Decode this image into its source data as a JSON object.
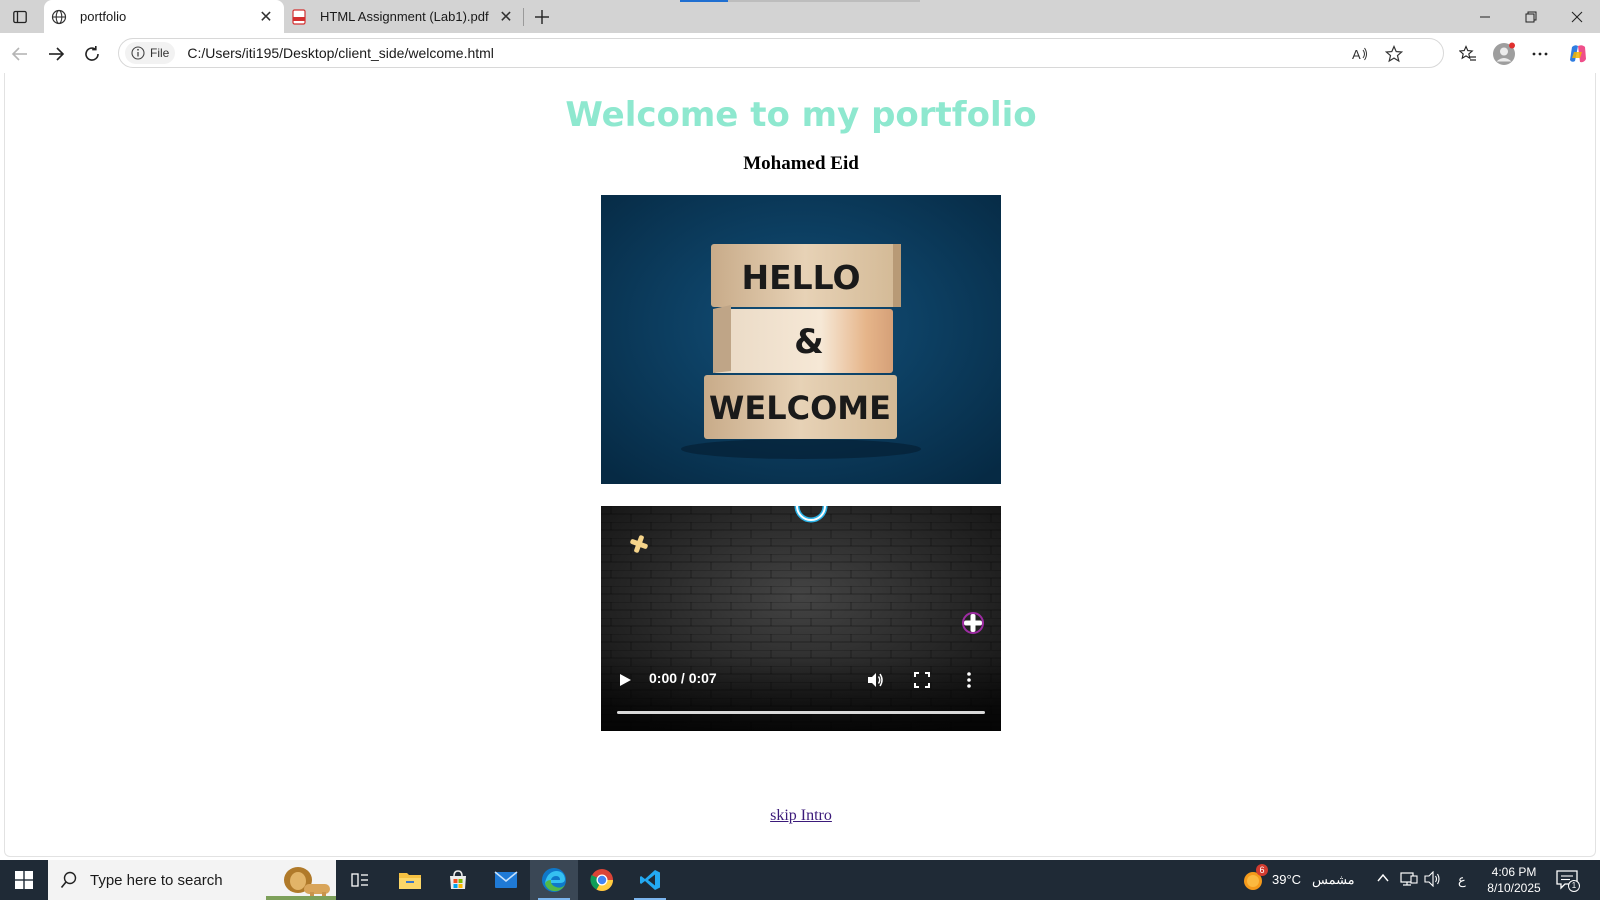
{
  "browser": {
    "tabs": [
      {
        "title": "portfolio",
        "active": true
      },
      {
        "title": "HTML Assignment (Lab1).pdf",
        "active": false
      }
    ],
    "address": {
      "site_label": "File",
      "url": "C:/Users/iti195/Desktop/client_side/welcome.html"
    }
  },
  "page": {
    "heading": "Welcome to my portfolio",
    "author": "Mohamed Eid",
    "hero_image": {
      "lines": [
        "HELLO",
        "&",
        "WELCOME"
      ]
    },
    "video": {
      "time": "0:00 / 0:07",
      "progress": 0
    },
    "skip_link": "skip Intro"
  },
  "taskbar": {
    "search_placeholder": "Type here to search",
    "weather": {
      "temp": "39°C",
      "condition": "مشمس",
      "badge": "6"
    },
    "language": "ع",
    "clock": {
      "time": "4:06 PM",
      "date": "8/10/2025"
    },
    "notification_count": "1"
  },
  "colors": {
    "heading": "#8ee8cf",
    "link": "#3b1a7a",
    "taskbar": "#1f2a36"
  }
}
